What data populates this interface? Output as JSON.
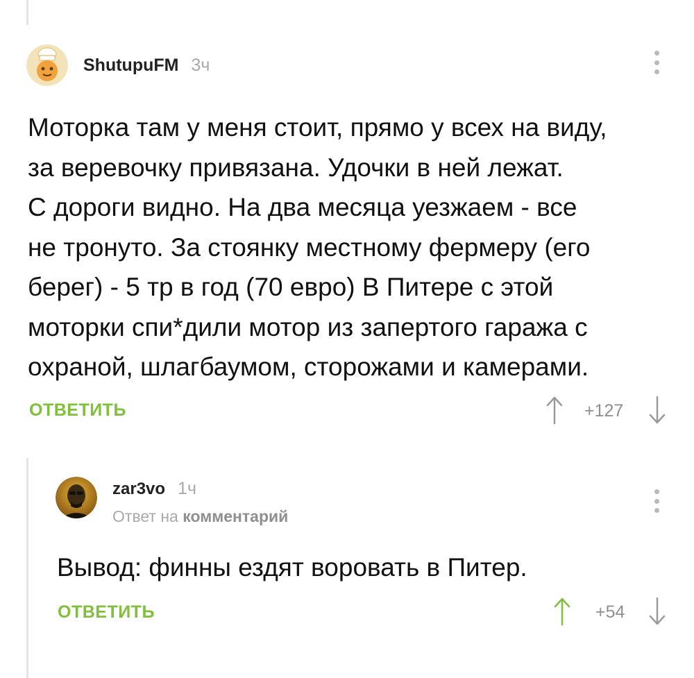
{
  "comment1": {
    "author": "ShutupuFM",
    "time": "3ч",
    "lines": [
      "Моторка там у меня стоит, прямо у всех на виду,",
      "за веревочку привязана. Удочки в ней лежат.",
      "С дороги видно. На два месяца уезжаем - все",
      "не тронуто. За стоянку местному фермеру (его",
      "берег) - 5 тр в год (70 евро) В Питере с этой",
      "моторки спи*дили мотор из запертого гаража с",
      "охраной, шлагбаумом, сторожами и камерами."
    ],
    "reply_label": "ОТВЕТИТЬ",
    "rating": "+127"
  },
  "comment2": {
    "author": "zar3vo",
    "time": "1ч",
    "reply_prefix": "Ответ на",
    "reply_target": "комментарий",
    "text": "Вывод: финны ездят воровать в Питер.",
    "reply_label": "ОТВЕТИТЬ",
    "rating": "+54"
  },
  "colors": {
    "accent_green": "#7fbf3a",
    "muted": "#a9a9a9",
    "thread_line": "#e4e4e4"
  },
  "icons": [
    "kebab-menu-icon",
    "arrow-up-icon",
    "arrow-down-icon"
  ]
}
